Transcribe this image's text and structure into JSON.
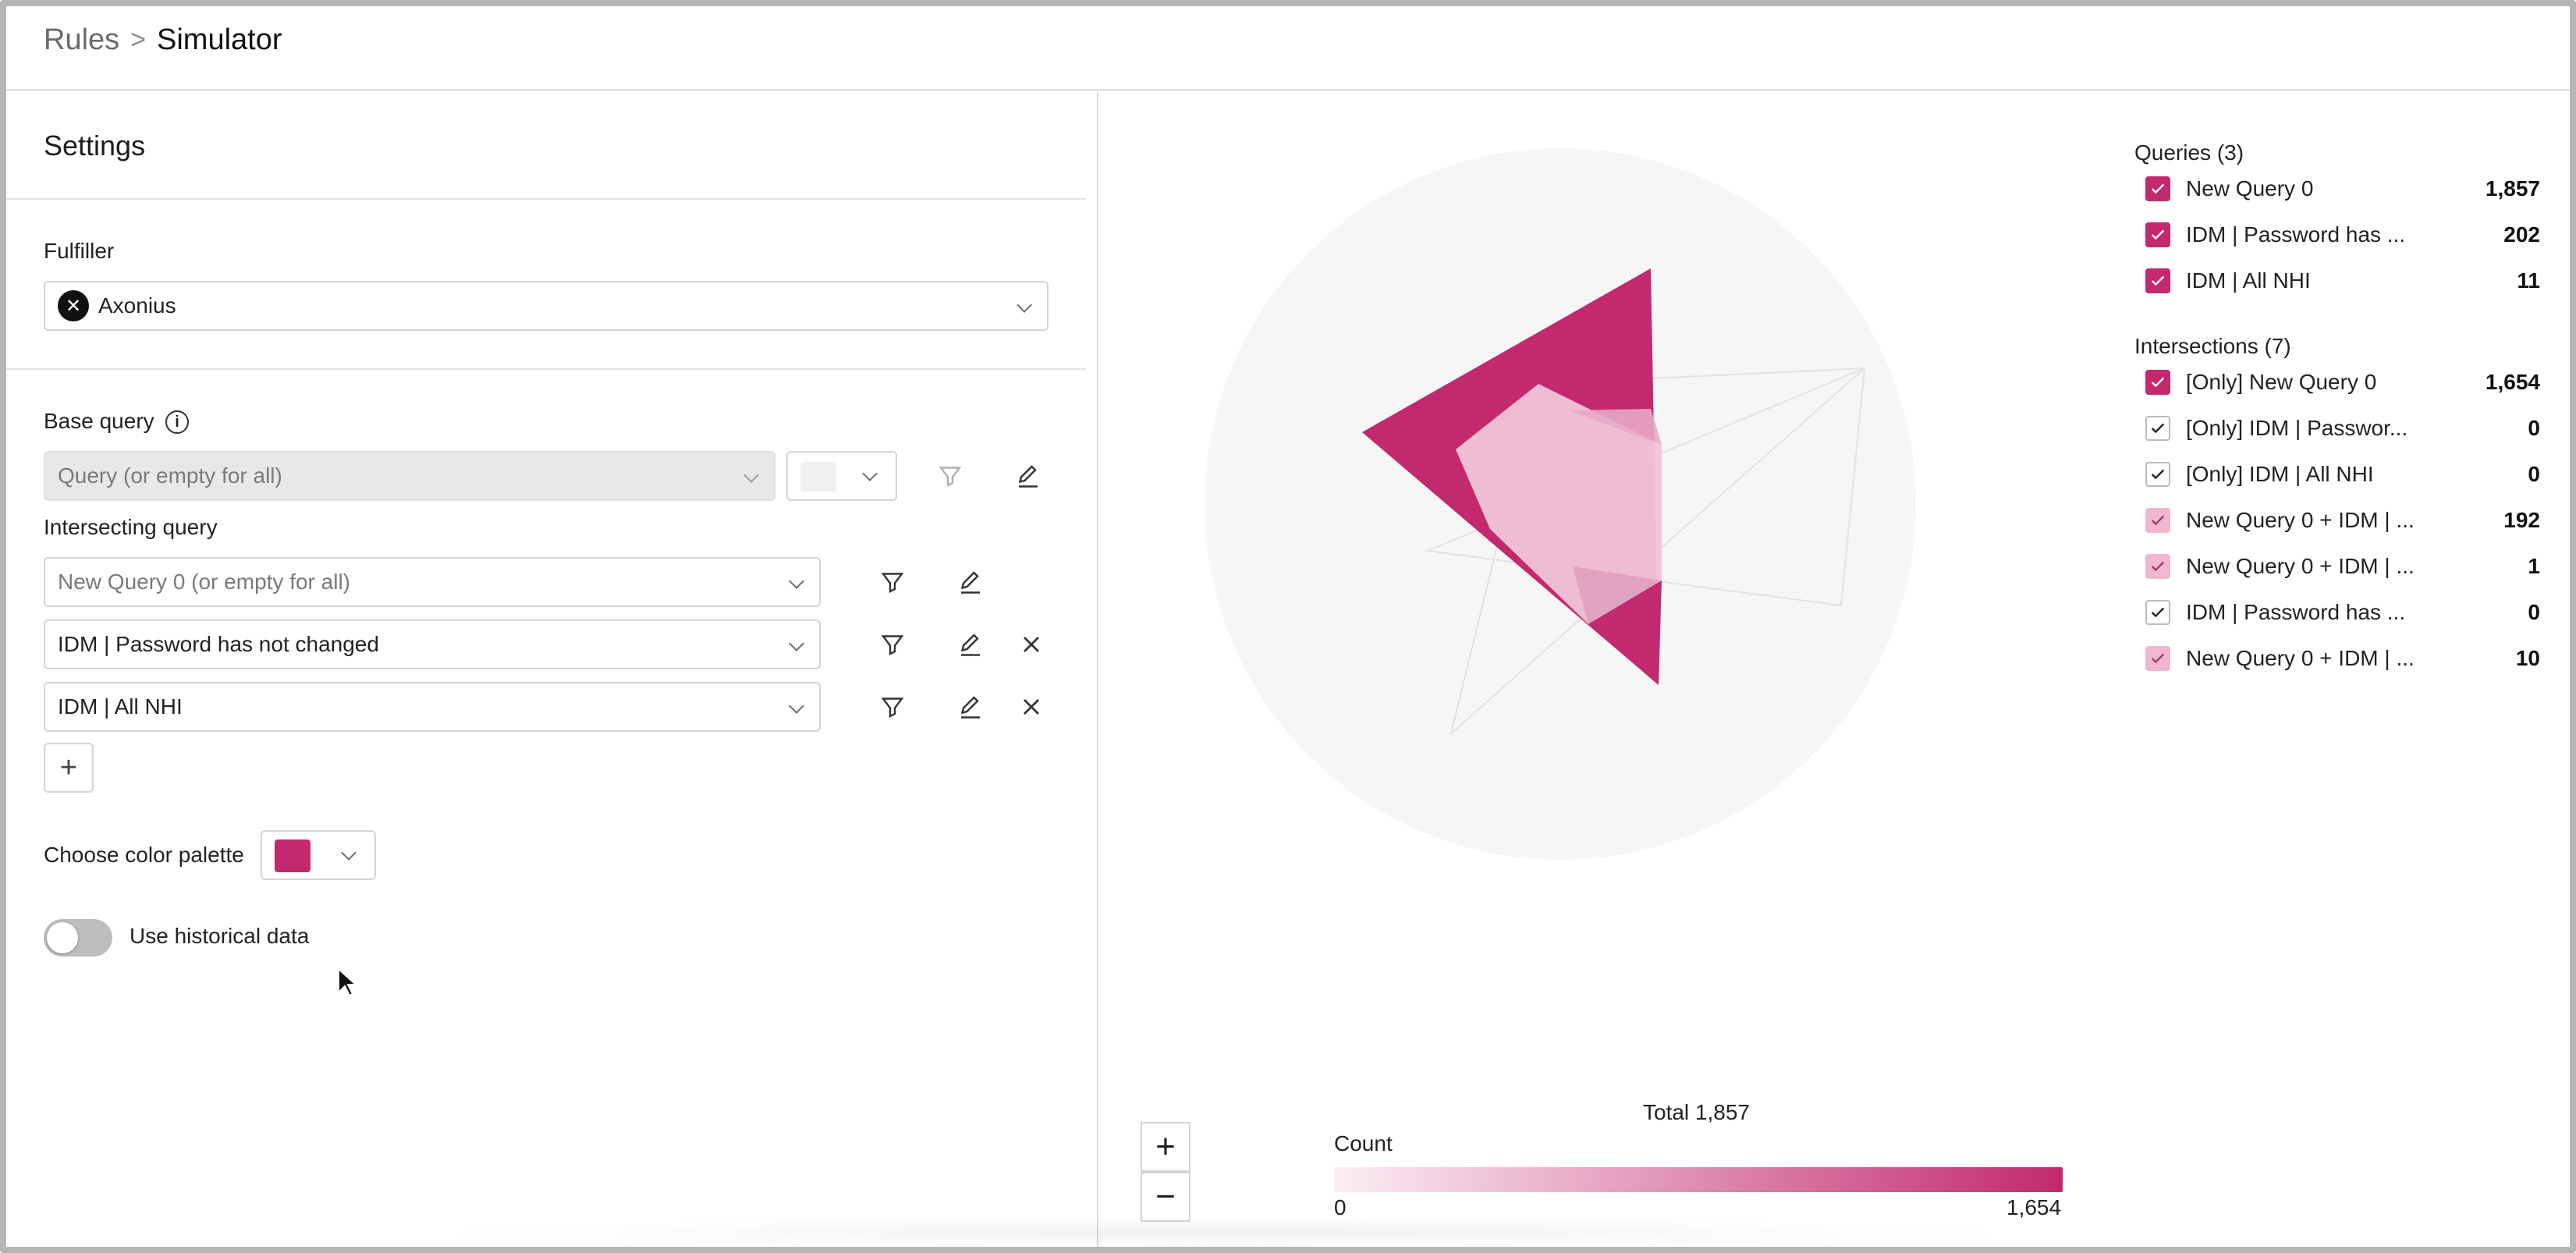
{
  "breadcrumb": {
    "parent": "Rules",
    "separator": ">",
    "current": "Simulator"
  },
  "settings": {
    "title": "Settings",
    "fulfiller_label": "Fulfiller",
    "fulfiller_value": "Axonius",
    "base_query_label": "Base query",
    "base_query_placeholder": "Query (or empty for all)",
    "intersecting_label": "Intersecting query",
    "intersecting_queries": [
      "New Query 0 (or empty for all)",
      "IDM | Password has not changed",
      "IDM | All NHI"
    ],
    "add_label": "+",
    "palette_label": "Choose color palette",
    "palette_color": "#c2296f",
    "historical_label": "Use historical data",
    "historical_on": false
  },
  "legend": {
    "queries_title": "Queries (3)",
    "queries": [
      {
        "label": "New Query 0",
        "count": "1,857"
      },
      {
        "label": "IDM | Password has ...",
        "count": "202"
      },
      {
        "label": "IDM | All NHI",
        "count": "11"
      }
    ],
    "intersections_title": "Intersections (7)",
    "intersections": [
      {
        "label": "[Only] New Query 0",
        "count": "1,654",
        "color": "#c2296f",
        "style": "filled"
      },
      {
        "label": "[Only] IDM | Passwor...",
        "count": "0",
        "color": "#ffffff",
        "style": "outline"
      },
      {
        "label": "[Only] IDM | All NHI",
        "count": "0",
        "color": "#ffffff",
        "style": "outline"
      },
      {
        "label": "New Query 0 + IDM | ...",
        "count": "192",
        "color": "#f0b8d0",
        "style": "light"
      },
      {
        "label": "New Query 0 + IDM | ...",
        "count": "1",
        "color": "#f0b8d0",
        "style": "light"
      },
      {
        "label": "IDM | Password has ...",
        "count": "0",
        "color": "#ffffff",
        "style": "outline"
      },
      {
        "label": "New Query 0 + IDM | ...",
        "count": "10",
        "color": "#f0b8d0",
        "style": "light"
      }
    ]
  },
  "chart": {
    "total_label": "Total 1,857",
    "scale_title": "Count",
    "scale_min": "0",
    "scale_max": "1,654",
    "zoom_in": "+",
    "zoom_out": "−",
    "accent": "#c2296f"
  }
}
